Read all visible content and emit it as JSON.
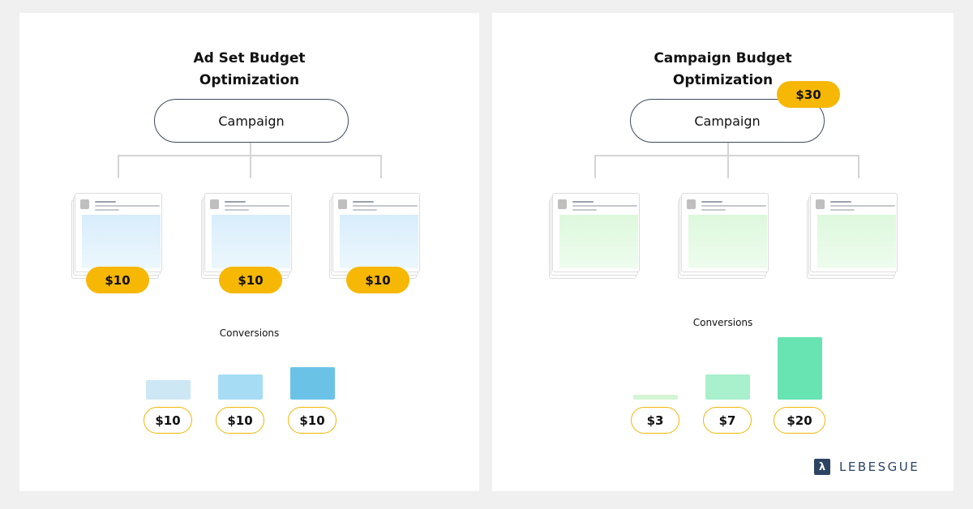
{
  "panels": [
    {
      "title_line1": "Ad Set Budget",
      "title_line2": "Optimization",
      "campaign_label": "Campaign",
      "adset_budgets": [
        "$10",
        "$10",
        "$10"
      ],
      "conversions_label": "Conversions",
      "conversions": [
        {
          "spend": "$10",
          "value": 10,
          "color": "#cde7f5"
        },
        {
          "spend": "$10",
          "value": 10,
          "color": "#a6dcf4"
        },
        {
          "spend": "$10",
          "value": 10,
          "color": "#6ac3e7"
        }
      ]
    },
    {
      "title_line1": "Campaign Budget",
      "title_line2": "Optimization",
      "campaign_label": "Campaign",
      "campaign_budget": "$30",
      "conversions_label": "Conversions",
      "conversions": [
        {
          "spend": "$3",
          "value": 3,
          "color": "#d4f5d3"
        },
        {
          "spend": "$7",
          "value": 7,
          "color": "#a9f0cc"
        },
        {
          "spend": "$20",
          "value": 20,
          "color": "#68e3b2"
        }
      ]
    }
  ],
  "brand": {
    "name": "LEBESGUE",
    "mark": "λ"
  },
  "colors": {
    "budget_pill": "#f7b705",
    "pill_outline": "#f2b705",
    "brand": "#2c4462"
  }
}
